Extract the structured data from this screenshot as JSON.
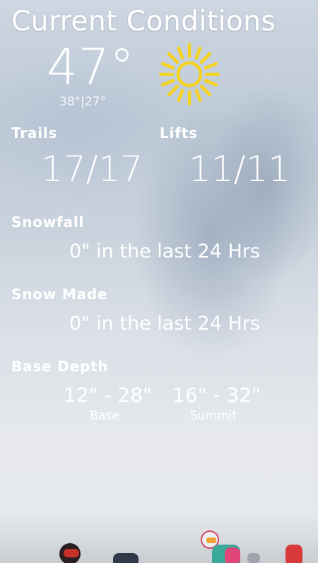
{
  "header": {
    "title": "Current Conditions"
  },
  "weather": {
    "temperature": "47°",
    "high_low": "38°|27°",
    "icon": "sun-icon",
    "icon_color": "#f5d21e"
  },
  "trails": {
    "label": "Trails",
    "value": "17/17"
  },
  "lifts": {
    "label": "Lifts",
    "value": "11/11"
  },
  "snowfall": {
    "label": "Snowfall",
    "value": "0\" in the last 24 Hrs"
  },
  "snow_made": {
    "label": "Snow Made",
    "value": "0\" in the last 24 Hrs"
  },
  "base_depth": {
    "label": "Base Depth",
    "base_value": "12\" - 28\"",
    "base_caption": "Base",
    "summit_value": "16\" - 32\"",
    "summit_caption": "Summit"
  }
}
